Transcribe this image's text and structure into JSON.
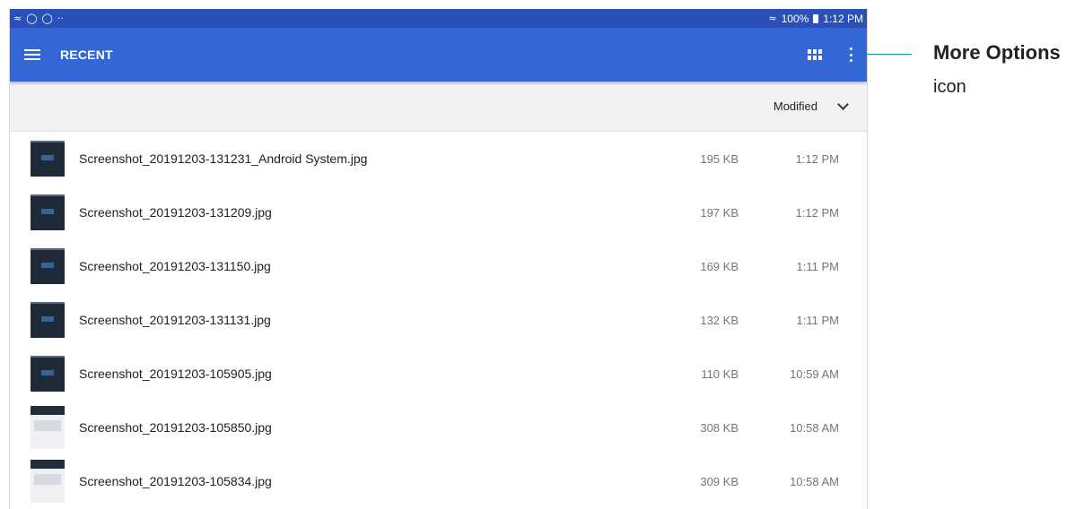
{
  "statusbar": {
    "left_icons": [
      "wifi-calling-icon",
      "sync-icon",
      "sync-icon",
      "more-dots-icon"
    ],
    "signal_icon": "wifi-icon",
    "battery_text": "100%",
    "time": "1:12 PM"
  },
  "appbar": {
    "title": "RECENT",
    "menu_icon": "hamburger-menu-icon",
    "grid_icon": "grid-view-icon",
    "more_icon": "more-options-icon"
  },
  "sort": {
    "label": "Modified",
    "icon": "chevron-down-icon"
  },
  "files": [
    {
      "name": "Screenshot_20191203-131231_Android System.jpg",
      "size": "195 KB",
      "time": "1:12 PM"
    },
    {
      "name": "Screenshot_20191203-131209.jpg",
      "size": "197 KB",
      "time": "1:12 PM"
    },
    {
      "name": "Screenshot_20191203-131150.jpg",
      "size": "169 KB",
      "time": "1:11 PM"
    },
    {
      "name": "Screenshot_20191203-131131.jpg",
      "size": "132 KB",
      "time": "1:11 PM"
    },
    {
      "name": "Screenshot_20191203-105905.jpg",
      "size": "110 KB",
      "time": "10:59 AM"
    },
    {
      "name": "Screenshot_20191203-105850.jpg",
      "size": "308 KB",
      "time": "10:58 AM"
    },
    {
      "name": "Screenshot_20191203-105834.jpg",
      "size": "309 KB",
      "time": "10:58 AM"
    }
  ],
  "callout": {
    "title": "More Options",
    "subtitle": "icon",
    "color": "#00a39a"
  },
  "colors": {
    "statusbar": "#2a4fb8",
    "appbar": "#3367d6",
    "sortbar": "#f2f2f2"
  }
}
